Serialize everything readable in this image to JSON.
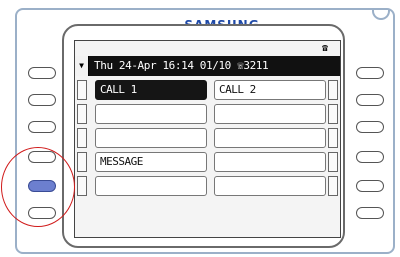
{
  "brand": "SAMSUNG",
  "screen": {
    "status_icon": "phone-handset-icon",
    "status_arrow": "▼",
    "status_text": "Thu 24-Apr 16:14 01/10 ☏3211",
    "rows": [
      {
        "left": "CALL 1",
        "right": "CALL 2",
        "left_active": true
      },
      {
        "left": "",
        "right": "",
        "left_active": false
      },
      {
        "left": "",
        "right": "",
        "left_active": false
      },
      {
        "left": "MESSAGE",
        "right": "",
        "left_active": false
      },
      {
        "left": "",
        "right": "",
        "left_active": false
      }
    ]
  },
  "soft_keys": {
    "left_count": 6,
    "right_count": 6,
    "highlighted_left_index": 4,
    "highlight_color": "#6c7fcf",
    "ring_color": "#d01a1a"
  }
}
